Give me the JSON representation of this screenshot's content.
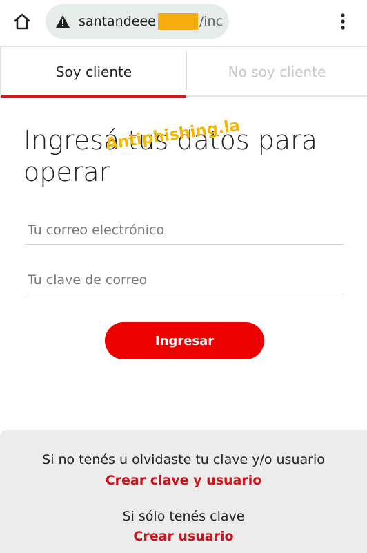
{
  "browser": {
    "url_visible_prefix": "santandeee",
    "url_visible_suffix": "/inc",
    "icons": {
      "home": "home-icon",
      "security": "warning-triangle-icon",
      "menu": "kebab-menu-icon"
    }
  },
  "tabs": [
    {
      "label": "Soy cliente",
      "active": true
    },
    {
      "label": "No soy cliente",
      "active": false
    }
  ],
  "form": {
    "heading": "Ingresá tus datos para operar",
    "email_placeholder": "Tu correo electrónico",
    "password_placeholder": "Tu clave de correo",
    "submit_label": "Ingresar"
  },
  "watermark": "Antiphishing.la",
  "footer": {
    "forgot_text": "Si no tenés u olvidaste tu clave y/o usuario",
    "forgot_link": "Crear clave y usuario",
    "only_key_text": "Si sólo tenés clave",
    "only_key_link": "Crear usuario"
  },
  "colors": {
    "brand_red": "#ec0000",
    "link_red": "#d0121a",
    "watermark_yellow": "#f2b705",
    "redaction_orange": "#f6ab0e"
  }
}
